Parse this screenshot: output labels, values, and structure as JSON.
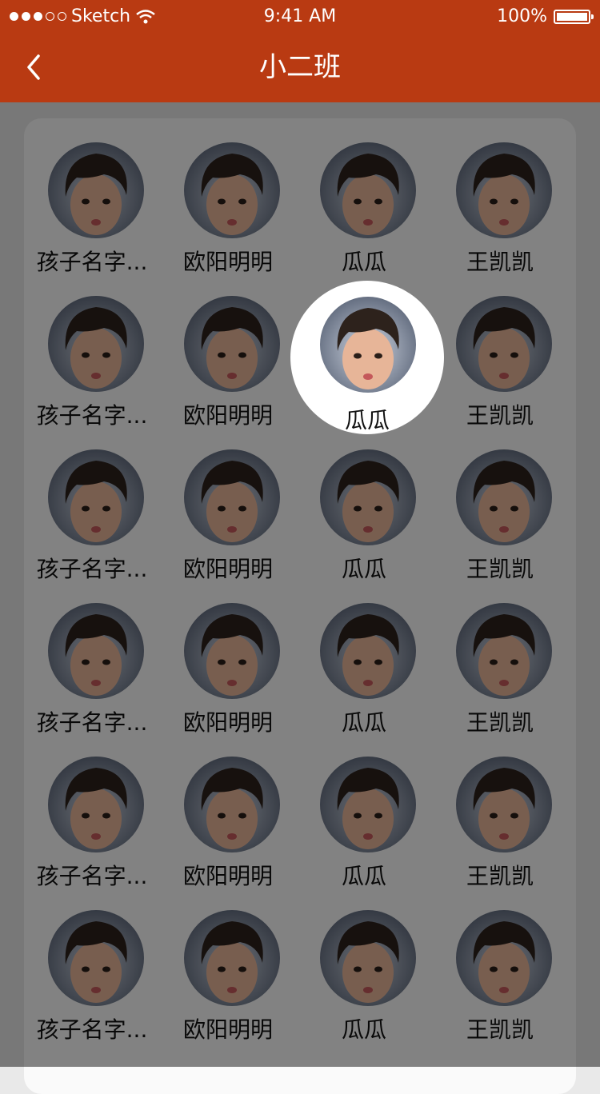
{
  "status_bar": {
    "carrier": "Sketch",
    "signal_icon": "signal-dots-icon",
    "wifi_icon": "wifi-icon",
    "time": "9:41 AM",
    "battery_percent": "100%",
    "battery_icon": "battery-icon"
  },
  "nav": {
    "back_icon": "chevron-left-icon",
    "title": "小二班"
  },
  "colors": {
    "nav_bar": "#b93a12",
    "overlay": "rgba(0,0,0,0.48)",
    "card": "#fafafa"
  },
  "students": [
    [
      "孩子名字...",
      "欧阳明明",
      "瓜瓜",
      "王凯凯"
    ],
    [
      "孩子名字...",
      "欧阳明明",
      "瓜瓜",
      "王凯凯"
    ],
    [
      "孩子名字...",
      "欧阳明明",
      "瓜瓜",
      "王凯凯"
    ],
    [
      "孩子名字...",
      "欧阳明明",
      "瓜瓜",
      "王凯凯"
    ],
    [
      "孩子名字...",
      "欧阳明明",
      "瓜瓜",
      "王凯凯"
    ],
    [
      "孩子名字...",
      "欧阳明明",
      "瓜瓜",
      "王凯凯"
    ]
  ],
  "highlighted": {
    "name": "瓜瓜",
    "avatar_icon": "child-avatar-icon"
  }
}
